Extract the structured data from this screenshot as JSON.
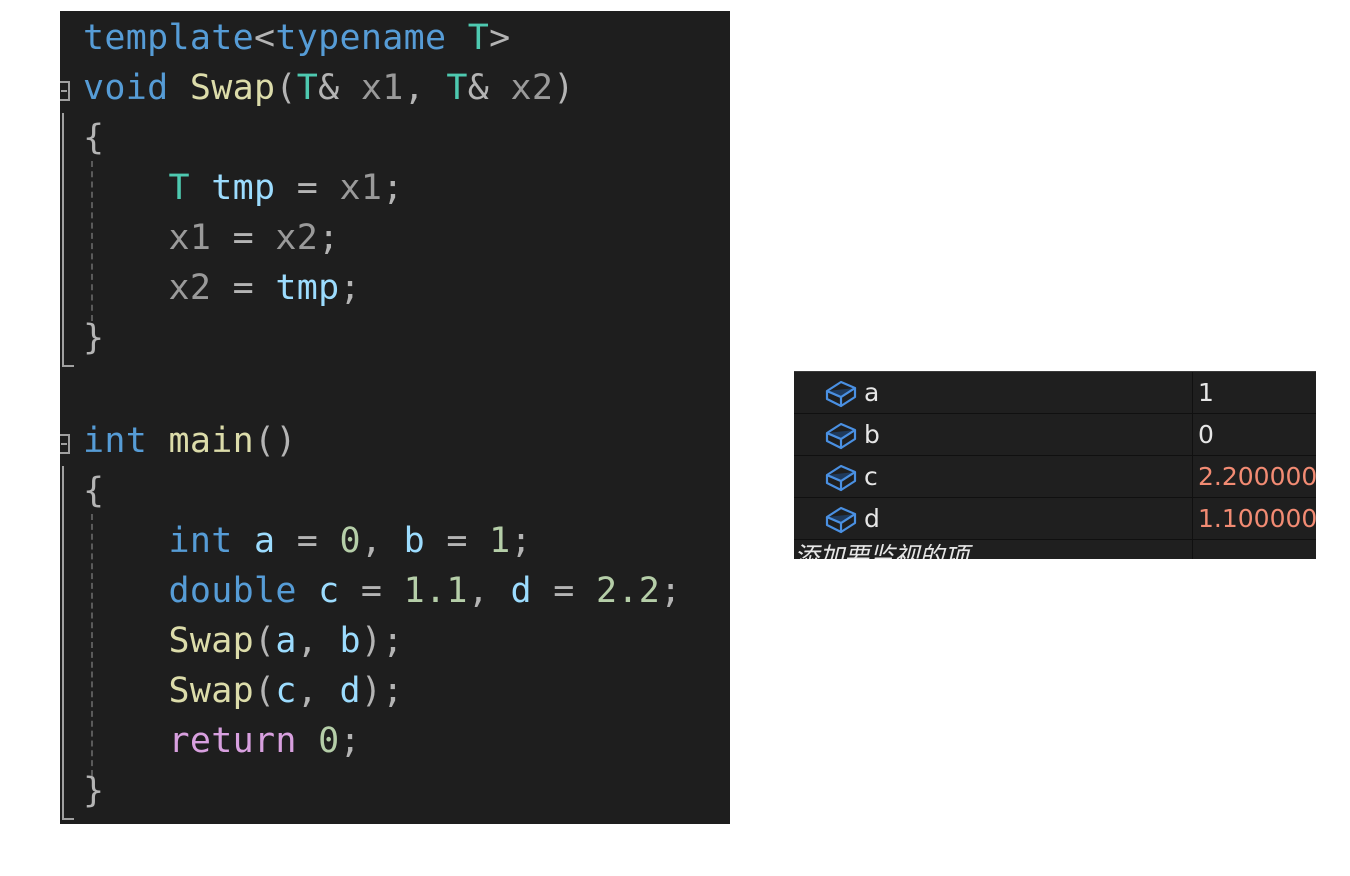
{
  "code": {
    "template": "template",
    "lt": "<",
    "typename": "typename",
    "T": "T",
    "gt": ">",
    "void": "void",
    "swap": "Swap",
    "open_paren": "(",
    "amp": "& ",
    "x1": "x1",
    "x2": "x2",
    "comma": ", ",
    "close_paren": ")",
    "lbrace": "{",
    "rbrace": "}",
    "tmp": "tmp",
    "eq": " = ",
    "semi": ";",
    "int": "int",
    "main": "main",
    "empty_parens": "()",
    "a": "a",
    "b": "b",
    "zero": "0",
    "one": "1",
    "double": "double",
    "c": "c",
    "d": "d",
    "n11": "1.1",
    "n22": "2.2",
    "ret": "return"
  },
  "watch": {
    "rows": [
      {
        "name": "a",
        "value": "1",
        "changed": false
      },
      {
        "name": "b",
        "value": "0",
        "changed": false
      },
      {
        "name": "c",
        "value": "2.200000",
        "changed": true
      },
      {
        "name": "d",
        "value": "1.100000",
        "changed": true
      }
    ],
    "add_item": "添加要监视的项",
    "icon": "variable-cube-icon"
  },
  "colors": {
    "editor_bg": "#1e1e1e",
    "keyword": "#569cd6",
    "type": "#4ec9b0",
    "function": "#dcdcaa",
    "variable": "#9cdcfe",
    "number": "#b5cea8",
    "control": "#d8a0df",
    "changed_value": "#f28b73"
  }
}
